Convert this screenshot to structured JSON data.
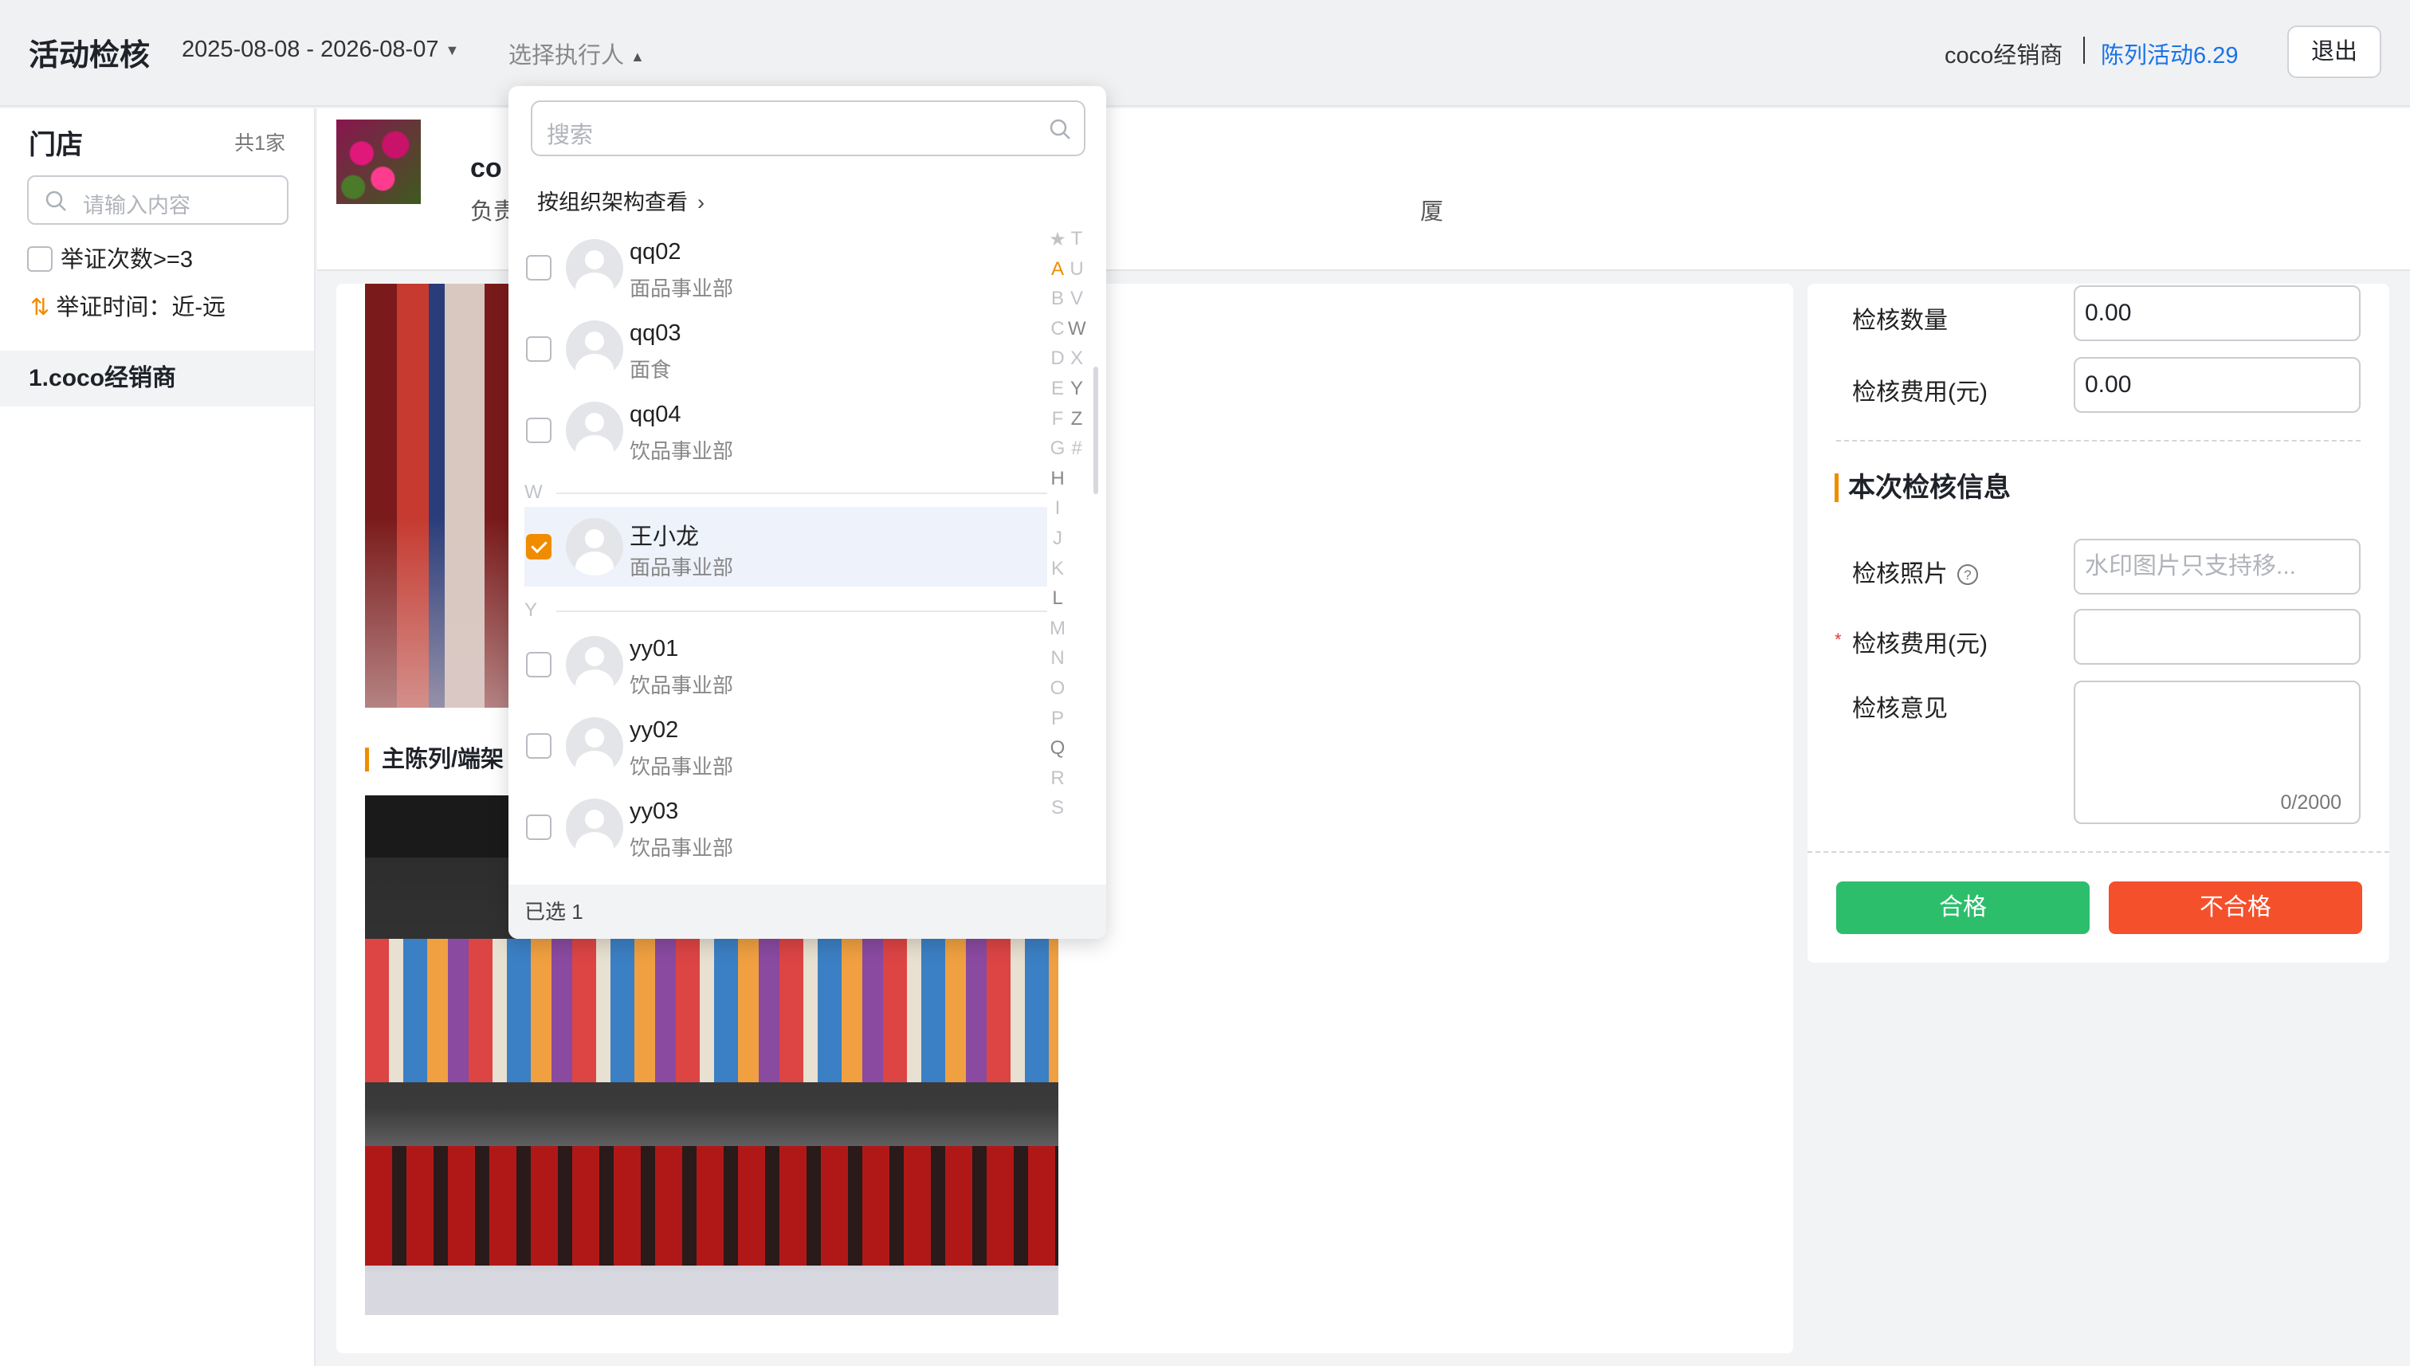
{
  "header": {
    "title": "活动检核",
    "date_range": "2025-08-08 - 2026-08-07",
    "executor_label": "选择执行人",
    "company": "coco经销商",
    "activity": "陈列活动6.29",
    "logout": "退出"
  },
  "left": {
    "title": "门店",
    "count": "共1家",
    "search_placeholder": "请输入内容",
    "filter_label": "举证次数>=3",
    "sort_label": "举证时间：近-远",
    "stores": [
      "1.coco经销商"
    ]
  },
  "store_band": {
    "name": "co",
    "owner": "负责",
    "address_tail": "厦"
  },
  "main": {
    "section_title": "主陈列/端架"
  },
  "right_panel": {
    "qty_label": "检核数量",
    "qty_value": "0.00",
    "fee_label": "检核费用(元)",
    "fee_value": "0.00",
    "info_title": "本次检核信息",
    "photo_label": "检核照片",
    "photo_placeholder": "水印图片只支持移...",
    "required_mark": "*",
    "fee2_label": "检核费用(元)",
    "opinion_label": "检核意见",
    "opinion_counter": "0/2000",
    "pass_button": "合格",
    "fail_button": "不合格"
  },
  "dropdown": {
    "search_placeholder": "搜索",
    "org_view": "按组织架构查看",
    "groups": [
      {
        "letter": "",
        "items": [
          {
            "name": "qq02",
            "dept": "面品事业部",
            "checked": false
          },
          {
            "name": "qq03",
            "dept": "面食",
            "checked": false
          },
          {
            "name": "qq04",
            "dept": "饮品事业部",
            "checked": false
          }
        ]
      },
      {
        "letter": "W",
        "items": [
          {
            "name": "王小龙",
            "dept": "面品事业部",
            "checked": true
          }
        ]
      },
      {
        "letter": "Y",
        "items": [
          {
            "name": "yy01",
            "dept": "饮品事业部",
            "checked": false
          },
          {
            "name": "yy02",
            "dept": "饮品事业部",
            "checked": false
          },
          {
            "name": "yy03",
            "dept": "饮品事业部",
            "checked": false
          }
        ]
      }
    ],
    "index_col1": [
      "★",
      "A",
      "B",
      "C",
      "D",
      "E",
      "F",
      "G",
      "H",
      "I",
      "J",
      "K",
      "L",
      "M",
      "N",
      "O",
      "P",
      "Q",
      "R",
      "S"
    ],
    "index_col2": [
      "T",
      "U",
      "V",
      "W",
      "X",
      "Y",
      "Z",
      "#"
    ],
    "selected_text": "已选 1"
  },
  "colors": {
    "accent": "#f08c00",
    "link": "#1a73e8",
    "pass": "#2dbe6c",
    "fail": "#f4502c"
  }
}
